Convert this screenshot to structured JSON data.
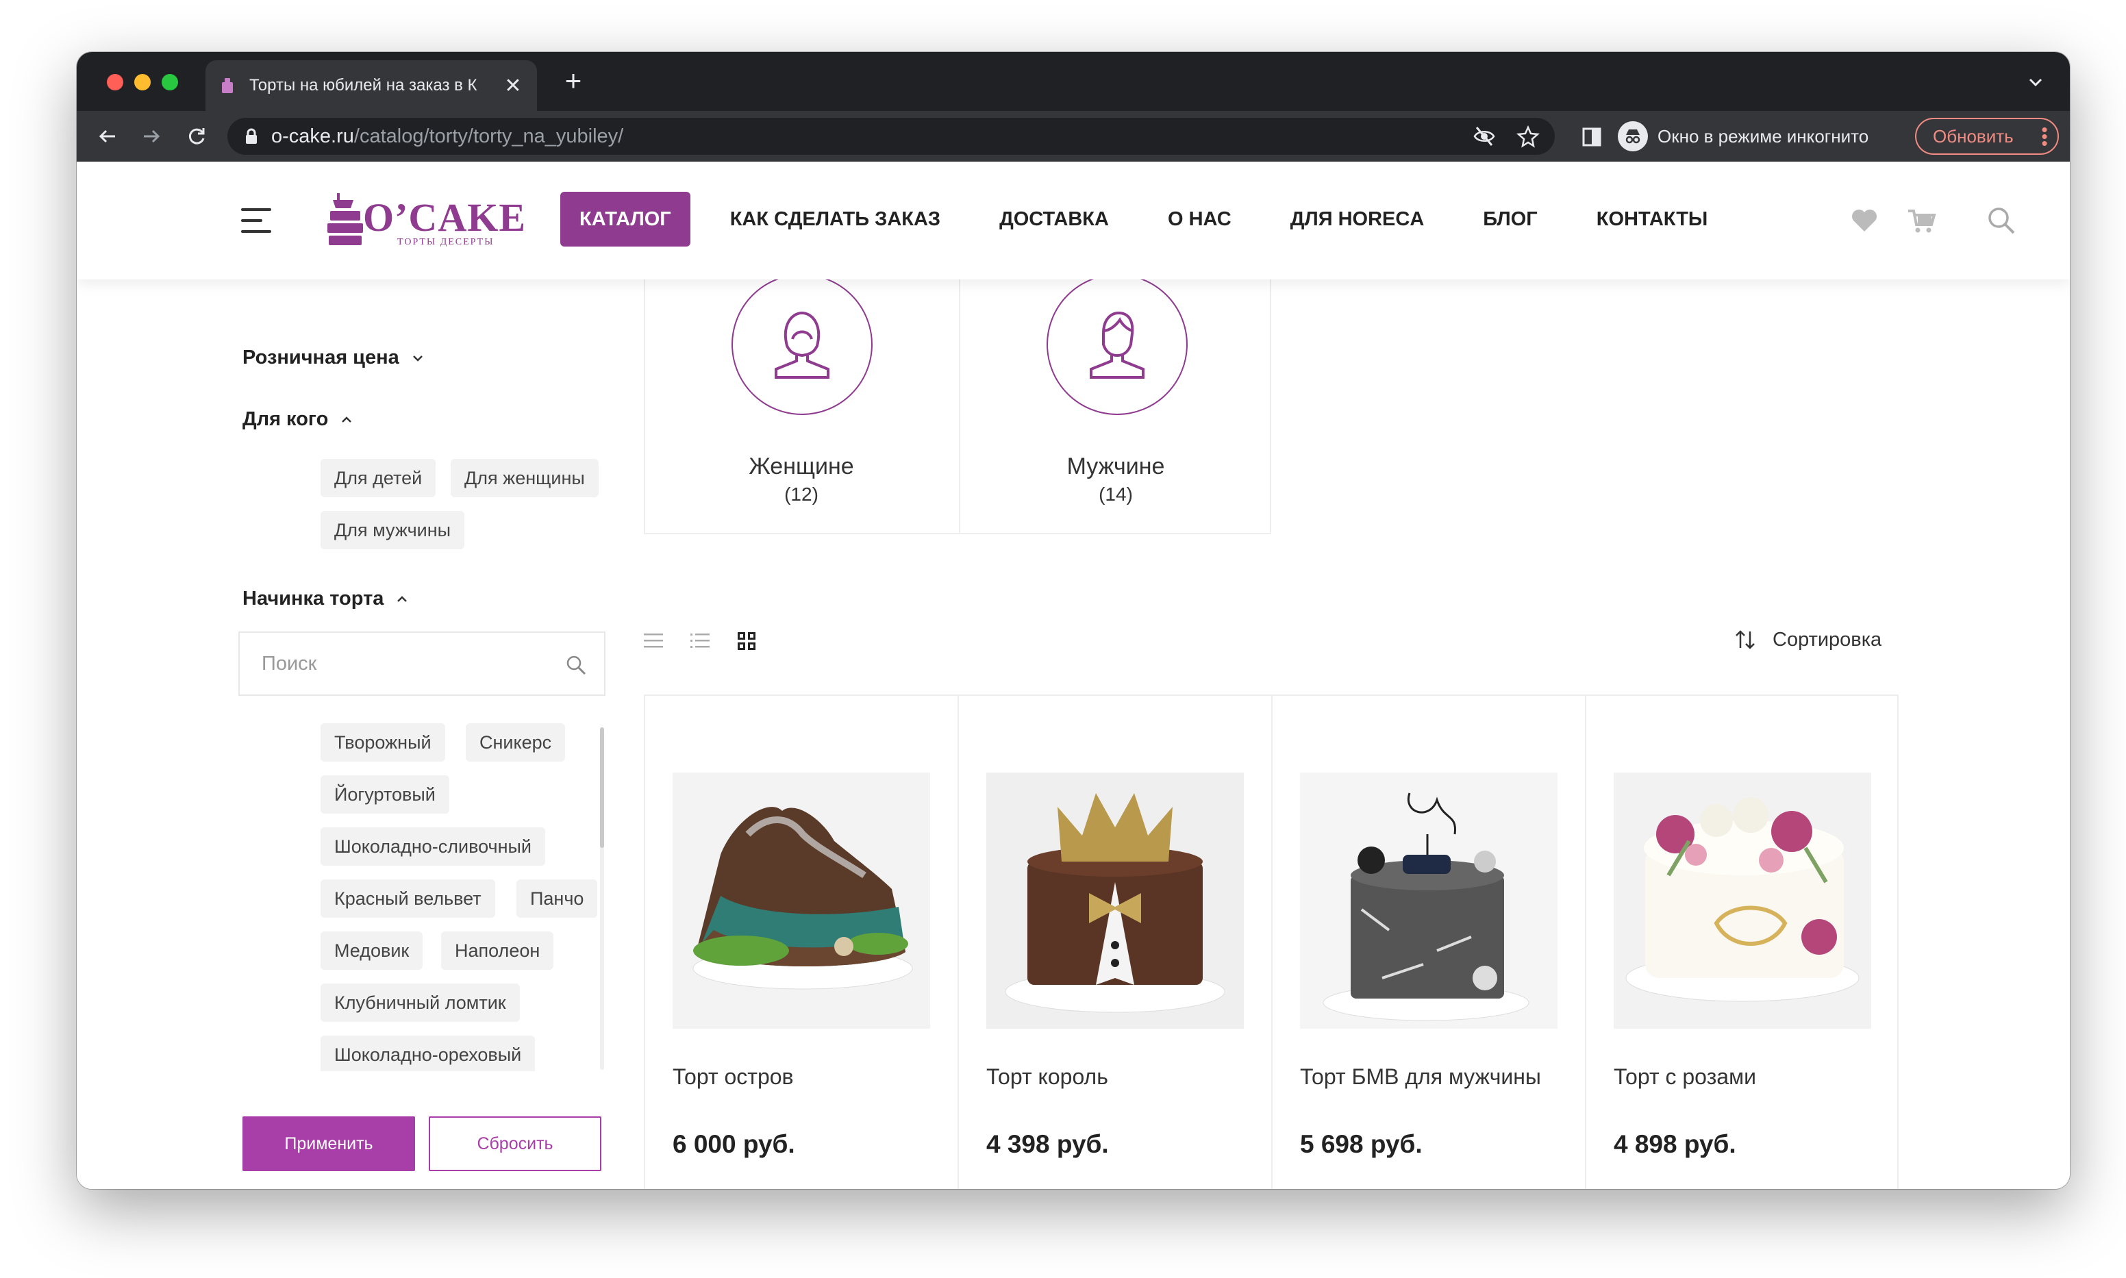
{
  "browser": {
    "tab_title": "Торты на юбилей на заказ в К",
    "url_host": "o-cake.ru",
    "url_path": "/catalog/torty/torty_na_yubiley/",
    "incognito_label": "Окно в режиме инкогнито",
    "update_label": "Обновить",
    "new_tab_symbol": "+",
    "close_symbol": "✕"
  },
  "header": {
    "logo_text": "O’CAKE",
    "logo_sub": "ТОРТЫ ДЕСЕРТЫ",
    "nav": [
      "КАТАЛОГ",
      "КАК СДЕЛАТЬ ЗАКАЗ",
      "ДОСТАВКА",
      "О НАС",
      "ДЛЯ HORECA",
      "БЛОГ",
      "КОНТАКТЫ"
    ]
  },
  "sidebar": {
    "price_title": "Розничная цена",
    "for_whom_title": "Для кого",
    "for_whom_chips": [
      "Для детей",
      "Для женщины",
      "Для мужчины"
    ],
    "filling_title": "Начинка торта",
    "search_placeholder": "Поиск",
    "filling_chips": [
      "Творожный",
      "Сникерс",
      "Йогуртовый",
      "Шоколадно-сливочный",
      "Красный вельвет",
      "Панчо",
      "Медовик",
      "Наполеон",
      "Клубничный ломтик",
      "Шоколадно-ореховый"
    ],
    "apply_label": "Применить",
    "reset_label": "Сбросить"
  },
  "categories": [
    {
      "name": "Женщине",
      "count": "(12)"
    },
    {
      "name": "Мужчине",
      "count": "(14)"
    }
  ],
  "sort_label": "Сортировка",
  "products": [
    {
      "name": "Торт остров",
      "price": "6 000 руб."
    },
    {
      "name": "Торт король",
      "price": "4 398 руб."
    },
    {
      "name": "Торт БМВ для мужчины",
      "price": "5 698 руб."
    },
    {
      "name": "Торт с розами",
      "price": "4 898 руб."
    }
  ],
  "colors": {
    "accent": "#8f3b8f",
    "button": "#a83ea8",
    "chrome_dark": "#202124",
    "chrome_toolbar": "#35363a",
    "update": "#f28b82"
  }
}
